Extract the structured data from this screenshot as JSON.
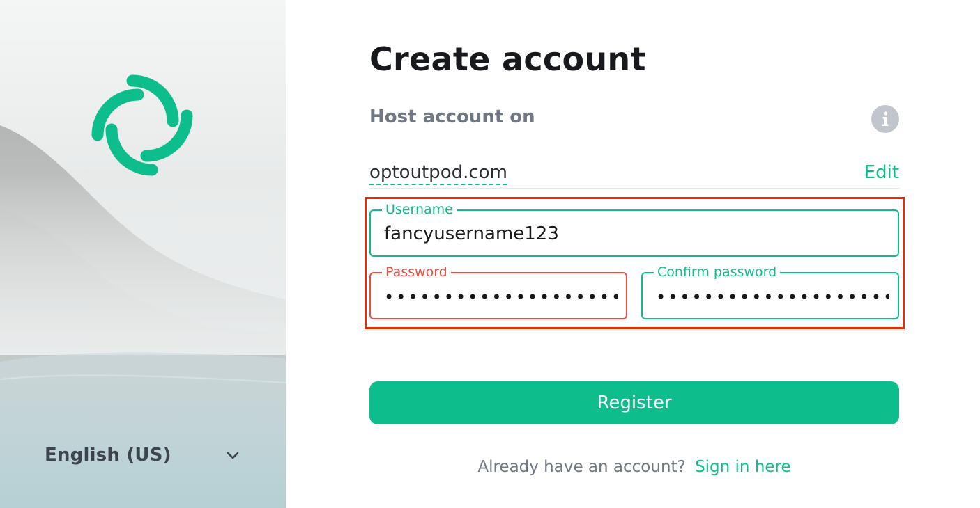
{
  "sidebar": {
    "language": {
      "selected": "English (US)",
      "chevron_icon": "chevron-down-icon"
    },
    "logo_icon": "element-logo-icon",
    "background": "misty-mountain-lake"
  },
  "form": {
    "title": "Create account",
    "host": {
      "label": "Host account on",
      "info_icon": "info-icon",
      "server": "optoutpod.com",
      "edit_label": "Edit"
    },
    "username": {
      "label": "Username",
      "value": "fancyusername123"
    },
    "password": {
      "label": "Password",
      "masked_value": "••••••••••••••••••••",
      "state": "error"
    },
    "confirm_password": {
      "label": "Confirm password",
      "masked_value": "••••••••••••••••••••"
    },
    "register_label": "Register",
    "signin": {
      "prompt": "Already have an account?",
      "link": "Sign in here"
    }
  },
  "colors": {
    "accent": "#0dbd8b",
    "error": "#ec4d42",
    "highlight": "#ee2a00",
    "text_primary": "#17191c",
    "text_secondary": "#6f7884"
  }
}
